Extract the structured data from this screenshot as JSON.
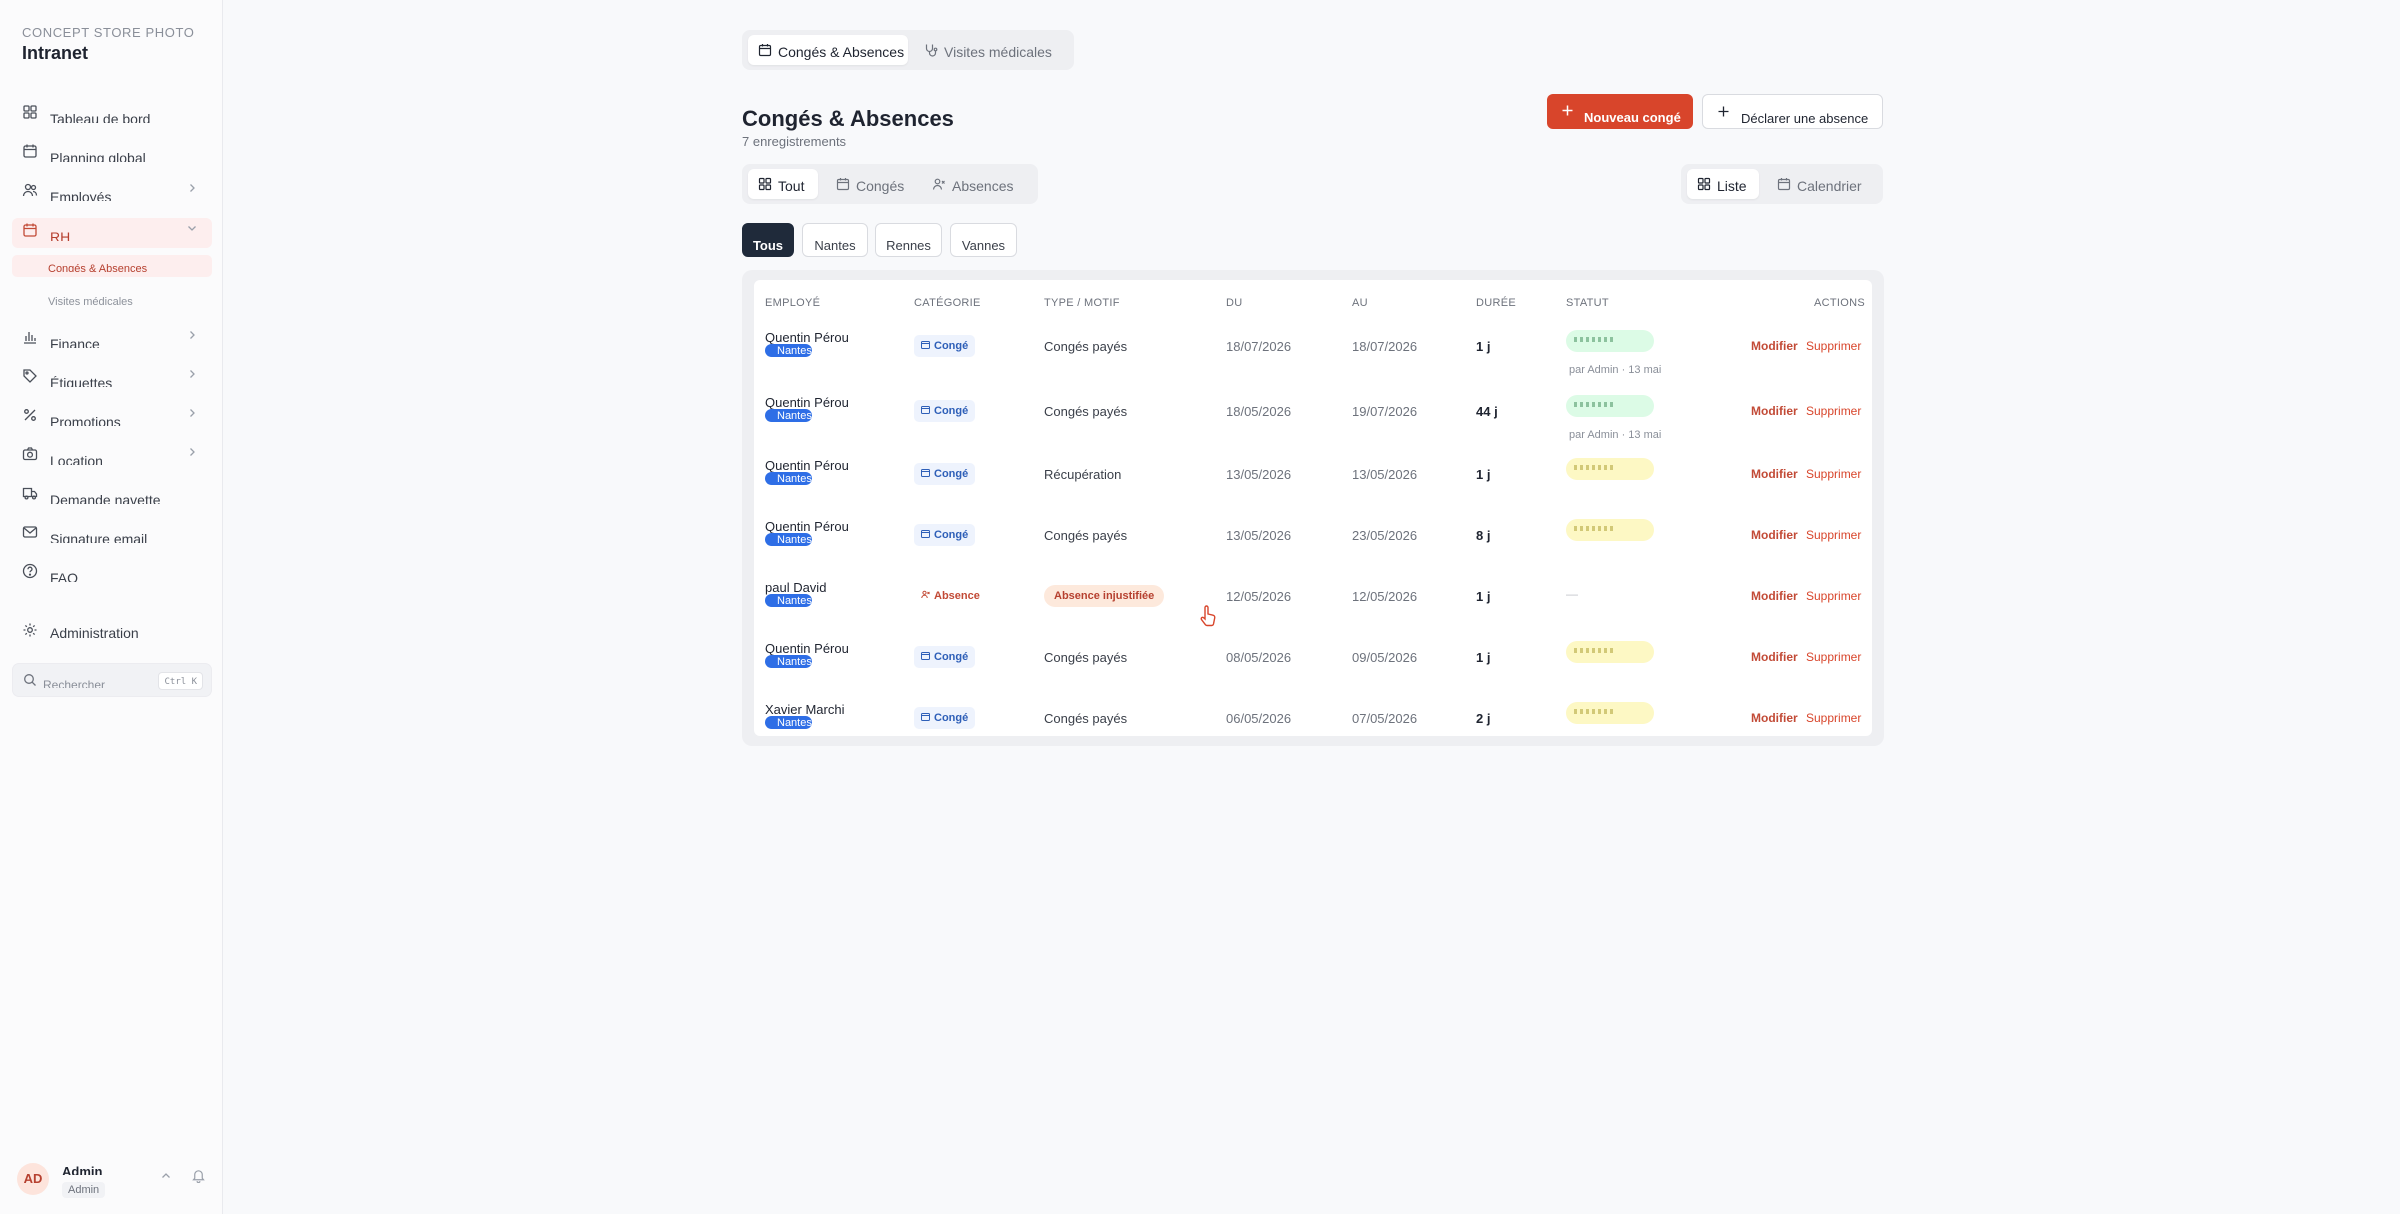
{
  "brand": {
    "subtitle": "CONCEPT STORE PHOTO",
    "title": "Intranet"
  },
  "sidebar": {
    "items": [
      {
        "label": "Tableau de bord",
        "icon": "dashboard-icon"
      },
      {
        "label": "Planning global",
        "icon": "calendar-icon"
      },
      {
        "label": "Employés",
        "icon": "users-icon"
      },
      {
        "label": "RH",
        "icon": "calendar-icon"
      },
      {
        "label": "Finance",
        "icon": "bar-chart-icon"
      },
      {
        "label": "Étiquettes",
        "icon": "tag-icon"
      },
      {
        "label": "Promotions",
        "icon": "percent-icon"
      },
      {
        "label": "Location",
        "icon": "camera-icon"
      },
      {
        "label": "Demande navette",
        "icon": "truck-icon"
      },
      {
        "label": "Signature email",
        "icon": "mail-icon"
      },
      {
        "label": "FAQ",
        "icon": "help-circle-icon"
      },
      {
        "label": "Administration",
        "icon": "gear-icon"
      }
    ],
    "sub_items": [
      {
        "label": "Congés & Absences"
      },
      {
        "label": "Visites médicales"
      }
    ],
    "search": {
      "placeholder": "Rechercher",
      "shortcut": "Ctrl K"
    },
    "user": {
      "initials": "AD",
      "name": "Admin",
      "role": "Admin"
    }
  },
  "top_tabs": [
    {
      "label": "Congés & Absences",
      "icon": "calendar-icon"
    },
    {
      "label": "Visites médicales",
      "icon": "stethoscope-icon"
    }
  ],
  "page": {
    "title": "Congés & Absences",
    "subtitle": "7 enregistrements"
  },
  "buttons": {
    "new_leave": "Nouveau congé",
    "declare_absence": "Déclarer une absence"
  },
  "filter_tabs": [
    {
      "label": "Tout",
      "icon": "grid-icon"
    },
    {
      "label": "Congés",
      "icon": "calendar-icon"
    },
    {
      "label": "Absences",
      "icon": "user-x-icon"
    }
  ],
  "view_tabs": [
    {
      "label": "Liste",
      "icon": "grid-icon"
    },
    {
      "label": "Calendrier",
      "icon": "calendar-icon"
    }
  ],
  "store_chips": [
    "Tous",
    "Nantes",
    "Rennes",
    "Vannes"
  ],
  "table": {
    "headers": [
      "Employé",
      "Catégorie",
      "Type / Motif",
      "Du",
      "Au",
      "Durée",
      "Statut",
      "Actions"
    ],
    "rows": [
      {
        "employee": "Quentin Pérou",
        "store": "Nantes",
        "category": "Congé",
        "motif": "Congés payés",
        "du": "18/07/2026",
        "au": "18/07/2026",
        "duree": "1 j",
        "status_by": "par Admin · 13 mai",
        "edit": "Modifier",
        "delete": "Supprimer"
      },
      {
        "employee": "Quentin Pérou",
        "store": "Nantes",
        "category": "Congé",
        "motif": "Congés payés",
        "du": "18/05/2026",
        "au": "19/07/2026",
        "duree": "44 j",
        "status_by": "par Admin · 13 mai",
        "edit": "Modifier",
        "delete": "Supprimer"
      },
      {
        "employee": "Quentin Pérou",
        "store": "Nantes",
        "category": "Congé",
        "motif": "Récupération",
        "du": "13/05/2026",
        "au": "13/05/2026",
        "duree": "1 j",
        "edit": "Modifier",
        "delete": "Supprimer"
      },
      {
        "employee": "Quentin Pérou",
        "store": "Nantes",
        "category": "Congé",
        "motif": "Congés payés",
        "du": "13/05/2026",
        "au": "23/05/2026",
        "duree": "8 j",
        "edit": "Modifier",
        "delete": "Supprimer"
      },
      {
        "employee": "paul David",
        "store": "Nantes",
        "category": "Absence",
        "motif": "Absence injustifiée",
        "du": "12/05/2026",
        "au": "12/05/2026",
        "duree": "1 j",
        "status_none": "—",
        "edit": "Modifier",
        "delete": "Supprimer"
      },
      {
        "employee": "Quentin Pérou",
        "store": "Nantes",
        "category": "Congé",
        "motif": "Congés payés",
        "du": "08/05/2026",
        "au": "09/05/2026",
        "duree": "1 j",
        "edit": "Modifier",
        "delete": "Supprimer"
      },
      {
        "employee": "Xavier Marchi",
        "store": "Nantes",
        "category": "Congé",
        "motif": "Congés payés",
        "du": "06/05/2026",
        "au": "07/05/2026",
        "duree": "2 j",
        "edit": "Modifier",
        "delete": "Supprimer"
      }
    ]
  },
  "colors": {
    "accent": "#d8452b",
    "active_bg": "#fdeeee",
    "status_approved": "#dcfbe6",
    "status_pending": "#fdf8c4",
    "store_badge": "#2e6ee6",
    "chip_active": "#1f2a3a"
  }
}
